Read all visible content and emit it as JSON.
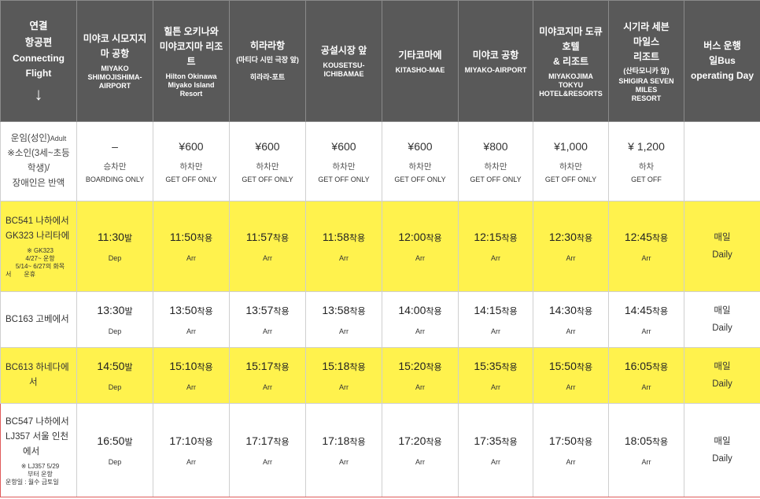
{
  "header": {
    "first": {
      "ko": [
        "연결",
        "항공편"
      ],
      "en": [
        "Connecting",
        "Flight"
      ],
      "arrow": "↓"
    },
    "stops": [
      {
        "ko": [
          "미야코 시모지지",
          "마 공항"
        ],
        "en": [
          "MIYAKO",
          "SHIMOJISHIMA-",
          "AIRPORT"
        ],
        "paren": ""
      },
      {
        "ko": [
          "힐튼 오키나와",
          "미야코지마 리조",
          "트"
        ],
        "en": [
          "Hilton Okinawa",
          "Miyako Island",
          "Resort"
        ],
        "paren": ""
      },
      {
        "ko": [
          "히라라항"
        ],
        "en": [],
        "paren": "(마티다 시민 극장 앞)",
        "extra": "히라라-포트"
      },
      {
        "ko": [
          "공설시장 앞"
        ],
        "en": [
          "KOUSETSU-",
          "ICHIBAMAE"
        ],
        "paren": ""
      },
      {
        "ko": [
          "기타코마에"
        ],
        "en": [
          "KITASHO-MAE"
        ],
        "paren": ""
      },
      {
        "ko": [
          "미야코 공항"
        ],
        "en": [
          "MIYAKO-AIRPORT"
        ],
        "paren": ""
      },
      {
        "ko": [
          "미야코지마 도큐",
          "호텔",
          "& 리조트"
        ],
        "en": [
          "MIYAKOJIMA",
          "TOKYU",
          "HOTEL&RESORTS"
        ],
        "paren": ""
      },
      {
        "ko": [
          "시기라 세븐",
          "마일스",
          "리조트"
        ],
        "en": [
          "SHIGIRA SEVEN",
          "MILES",
          "RESORT"
        ],
        "paren": "(산타모니카 앞)"
      }
    ],
    "last": {
      "ko": [
        "버스 운행",
        "일Bus",
        "operating Day"
      ]
    }
  },
  "fare": {
    "label": [
      "운임(성인)",
      "※소인(3세~초등",
      "학생)/",
      "장애인은 반액"
    ],
    "adult": "Adult",
    "cells": [
      {
        "price": "–",
        "ko": "승차만",
        "en": "BOARDING ONLY"
      },
      {
        "price": "¥600",
        "ko": "하차만",
        "en": "GET OFF ONLY"
      },
      {
        "price": "¥600",
        "ko": "하차만",
        "en": "GET OFF ONLY"
      },
      {
        "price": "¥600",
        "ko": "하차만",
        "en": "GET OFF ONLY"
      },
      {
        "price": "¥600",
        "ko": "하차만",
        "en": "GET OFF ONLY"
      },
      {
        "price": "¥800",
        "ko": "하차만",
        "en": "GET OFF ONLY"
      },
      {
        "price": "¥1,000",
        "ko": "하차만",
        "en": "GET OFF ONLY"
      },
      {
        "price": "¥ 1,200",
        "ko": "하차",
        "en": "GET OFF"
      }
    ]
  },
  "dep_suffix": "발",
  "arr_suffix": "착용",
  "dep_tag": "Dep",
  "arr_tag": "Arr",
  "rows": [
    {
      "flight": [
        "BC541 나하에서",
        "GK323 나리타에"
      ],
      "note": [
        "※ GK323",
        "4/27~ 운항",
        "5/14~ 6/27의 화목",
        "서　　운휴"
      ],
      "times": [
        "11:30",
        "11:50",
        "11:57",
        "11:58",
        "12:00",
        "12:15",
        "12:30",
        "12:45"
      ],
      "days": [
        "매일",
        "Daily"
      ]
    },
    {
      "flight": [
        "BC163 고베에서"
      ],
      "note": [],
      "times": [
        "13:30",
        "13:50",
        "13:57",
        "13:58",
        "14:00",
        "14:15",
        "14:30",
        "14:45"
      ],
      "days": [
        "매일",
        "Daily"
      ]
    },
    {
      "flight": [
        "BC613 하네다에",
        "서"
      ],
      "note": [],
      "times": [
        "14:50",
        "15:10",
        "15:17",
        "15:18",
        "15:20",
        "15:35",
        "15:50",
        "16:05"
      ],
      "days": [
        "매일",
        "Daily"
      ]
    },
    {
      "flight": [
        "BC547 나하에서",
        "LJ357 서울 인천",
        "에서"
      ],
      "note": [
        "※ LJ357 5/29",
        "부터 운항",
        "운항일 : 월수 금토일"
      ],
      "times": [
        "16:50",
        "17:10",
        "17:17",
        "17:18",
        "17:20",
        "17:35",
        "17:50",
        "18:05"
      ],
      "days": [
        "매일",
        "Daily"
      ]
    }
  ]
}
